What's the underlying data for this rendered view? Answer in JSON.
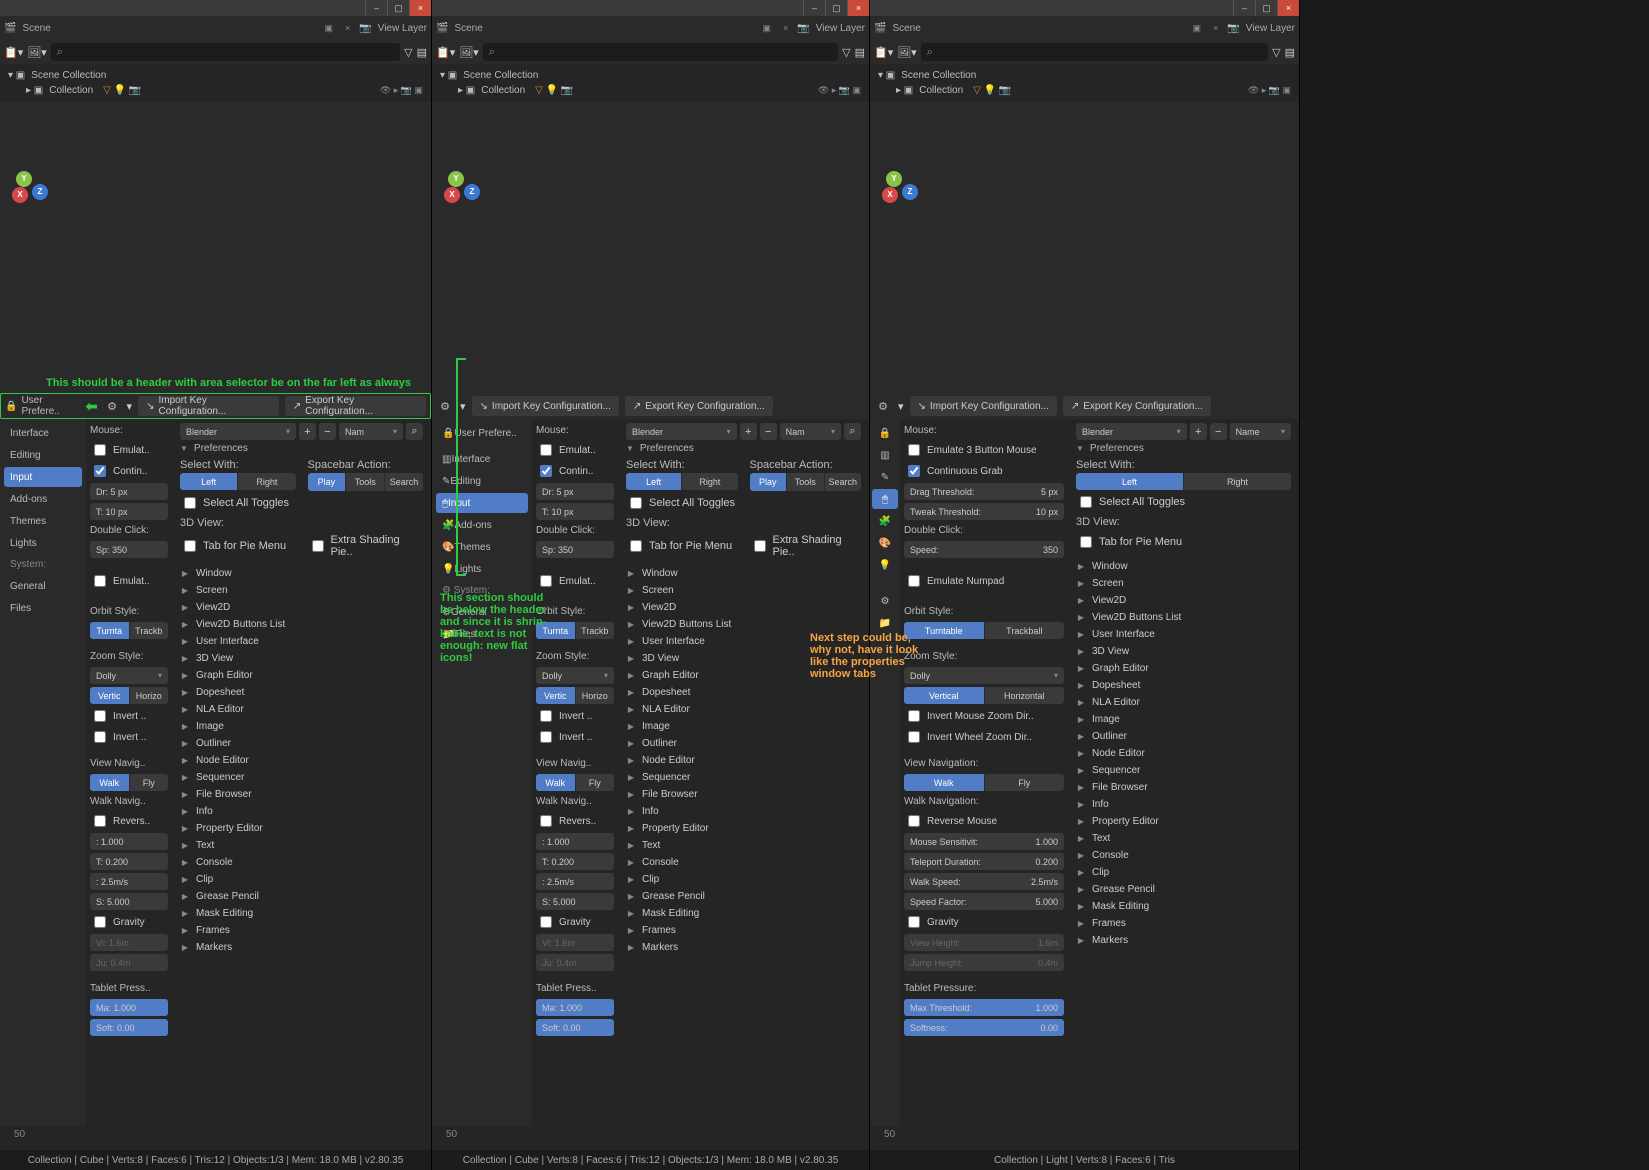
{
  "window_controls": {
    "min": "–",
    "max": "▢",
    "close": "×"
  },
  "top_header": {
    "scene_label": "Scene",
    "view_layer_label": "View Layer",
    "close_glyph": "×",
    "box_glyph": "▣"
  },
  "outliner": {
    "scene_collection": "Scene Collection",
    "collection": "Collection",
    "filter_glyph": "▽",
    "search_glyph": "⌕"
  },
  "prefs_header": {
    "user_prefs": "User Prefere..",
    "import_btn": "Import Key Configuration...",
    "export_btn": "Export Key Configuration...",
    "gear_glyph": "⚙",
    "arrow_glyph": "⬅"
  },
  "sidebar": {
    "items": [
      "Interface",
      "Editing",
      "Input",
      "Add-ons",
      "Themes",
      "Lights"
    ],
    "system_label": "System:",
    "system_items": [
      "General",
      "Files"
    ]
  },
  "midcol": {
    "mouse_label": "Mouse:",
    "emulate3btn": "Emulat..",
    "emulate3btn_full": "Emulate 3 Button Mouse",
    "contin": "Contin..",
    "contin_full": "Continuous Grab",
    "drag_thresh_short": "Dr: 5 px",
    "tweak_thresh_short": "T: 10 px",
    "drag_thresh": "Drag Threshold:",
    "drag_thresh_val": "5 px",
    "tweak_thresh": "Tweak Threshold:",
    "tweak_thresh_val": "10 px",
    "dbl_click": "Double Click:",
    "speed_short": "Sp: 350",
    "speed_label": "Speed:",
    "speed_val": "350",
    "emul_numpad": "Emulat..",
    "emul_numpad_full": "Emulate Numpad",
    "orbit_label": "Orbit Style:",
    "turntable": "Turnta",
    "turntable_full": "Turntable",
    "trackball": "Trackb",
    "trackball_full": "Trackball",
    "zoom_label": "Zoom Style:",
    "dolly": "Dolly",
    "vertical": "Vertic",
    "vertical_full": "Vertical",
    "horizontal": "Horizo",
    "horizontal_full": "Horizontal",
    "invert_mouse": "Invert ..",
    "invert_mouse_full": "Invert Mouse Zoom Dir..",
    "invert_wheel": "Invert ..",
    "invert_wheel_full": "Invert Wheel Zoom Dir..",
    "view_navig": "View Navig..",
    "view_navig_full": "View Navigation:",
    "walk": "Walk",
    "fly": "Fly",
    "walk_navig": "Walk Navig..",
    "walk_navig_full": "Walk Navigation:",
    "reverse": "Revers..",
    "reverse_full": "Reverse Mouse",
    "mouse_sens": "Mouse Sensitivit:",
    "mouse_sens_val": "1.000",
    "mouse_sens_short": ": 1.000",
    "teleport": "Teleport Duration:",
    "teleport_val": "0.200",
    "teleport_short": "T: 0.200",
    "walk_speed": "Walk Speed:",
    "walk_speed_val": "2.5m/s",
    "walk_speed_short": ": 2.5m/s",
    "speed_factor": "Speed Factor:",
    "speed_factor_val": "5.000",
    "speed_factor_short": "S: 5.000",
    "gravity": "Gravity",
    "view_height": "View Height:",
    "view_height_val": "1.6m",
    "view_height_short": "Vi: 1.6m",
    "jump_height": "Jump Height:",
    "jump_height_val": "0.4m",
    "jump_height_short": "Ju: 0.4m",
    "tablet": "Tablet Press..",
    "tablet_full": "Tablet Pressure:",
    "max_thresh": "Max Threshold:",
    "max_thresh_short": "Ma: 1.000",
    "max_thresh_val": "1.000",
    "softness": "Softness:",
    "softness_short": "Soft: 0.00",
    "softness_val": "0.00"
  },
  "rightcol": {
    "preset_blender": "Blender",
    "preset_name": "Nam",
    "preset_name_full": "Name",
    "prefs_section": "Preferences",
    "select_with": "Select With:",
    "left": "Left",
    "right": "Right",
    "spacebar": "Spacebar Action:",
    "play": "Play",
    "tools": "Tools",
    "search": "Search",
    "select_all_toggles": "Select All Toggles",
    "view3d": "3D View:",
    "tab_pie": "Tab for Pie Menu",
    "extra_shading": "Extra Shading Pie..",
    "categories": [
      "Window",
      "Screen",
      "View2D",
      "View2D Buttons List",
      "User Interface",
      "3D View",
      "Graph Editor",
      "Dopesheet",
      "NLA Editor",
      "Image",
      "Outliner",
      "Node Editor",
      "Sequencer",
      "File Browser",
      "Info",
      "Property Editor",
      "Text",
      "Console",
      "Clip",
      "Grease Pencil",
      "Mask Editing",
      "Frames",
      "Markers"
    ]
  },
  "annotations": {
    "ann1": "This should be a header with area selector be on the far left as always",
    "ann2": "This section should be below the header and since it is shrin-kable, text is not enough: new flat icons!",
    "ann3": "Next step could be, why not, have it look like the properties window tabs"
  },
  "status_bar": {
    "pane1": "Collection | Cube | Verts:8 | Faces:6 | Tris:12 | Objects:1/3 | Mem: 18.0 MB | v2.80.35",
    "pane2": "Collection | Cube | Verts:8 | Faces:6 | Tris:12 | Objects:1/3 | Mem: 18.0 MB | v2.80.35",
    "pane3": "Collection | Light | Verts:8 | Faces:6 | Tris"
  },
  "viewport_num": "50"
}
